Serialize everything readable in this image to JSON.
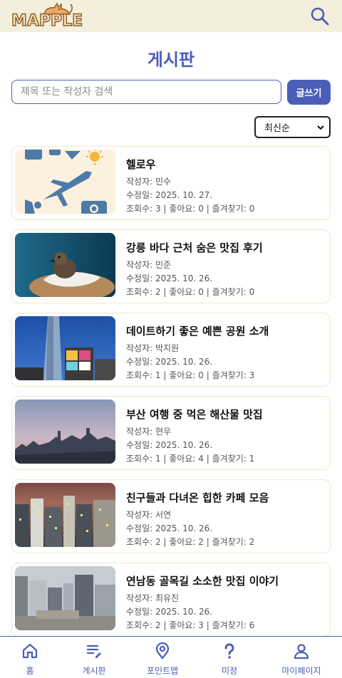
{
  "app": {
    "logo_text": "MAPPLE",
    "colors": {
      "primary": "#4a5fb8",
      "header_bg": "#f3efdc",
      "card_border": "#f0e9cc"
    }
  },
  "header": {
    "search_icon": "search-icon"
  },
  "board": {
    "title": "게시판"
  },
  "search": {
    "placeholder": "제목 또는 작성자 검색",
    "value": ""
  },
  "write_button": {
    "label": "글쓰기"
  },
  "sort": {
    "selected": "최신순"
  },
  "posts": [
    {
      "title": "헬로우",
      "author": "작성자: 민수",
      "date": "수정일: 2025. 10. 27.",
      "stats": "조회수: 3 | 좋아요: 0 | 즐겨찾기: 0",
      "thumb": "travel-icons"
    },
    {
      "title": "강릉 바다 근처 숨은 맛집 후기",
      "author": "작성자: 민준",
      "date": "수정일: 2025. 10. 26.",
      "stats": "조회수: 2 | 좋아요: 0 | 즐겨찾기: 0",
      "thumb": "bird-photo"
    },
    {
      "title": "데이트하기 좋은 예쁜 공원 소개",
      "author": "작성자: 박지원",
      "date": "수정일: 2025. 10. 26.",
      "stats": "조회수: 1 | 좋아요: 0 | 즐겨찾기: 3",
      "thumb": "tower-photo"
    },
    {
      "title": "부산 여행 중 먹은 해산물 맛집",
      "author": "작성자: 현우",
      "date": "수정일: 2025. 10. 26.",
      "stats": "조회수: 1 | 좋아요: 4 | 즐겨찾기: 1",
      "thumb": "skyline-photo"
    },
    {
      "title": "친구들과 다녀온 힙한 카페 모음",
      "author": "작성자: 서연",
      "date": "수정일: 2025. 10. 26.",
      "stats": "조회수: 2 | 좋아요: 2 | 즐겨찾기: 2",
      "thumb": "night-city-photo"
    },
    {
      "title": "연남동 골목길 소소한 맛집 이야기",
      "author": "작성자: 최유진",
      "date": "수정일: 2025. 10. 26.",
      "stats": "조회수: 2 | 좋아요: 3 | 즐겨찾기: 6",
      "thumb": "city-aerial-photo"
    }
  ],
  "nav": [
    {
      "label": "홈",
      "icon": "home-icon"
    },
    {
      "label": "게시판",
      "icon": "board-icon"
    },
    {
      "label": "포인트맵",
      "icon": "map-pin-icon"
    },
    {
      "label": "미정",
      "icon": "question-icon"
    },
    {
      "label": "마이페이지",
      "icon": "user-icon"
    }
  ]
}
